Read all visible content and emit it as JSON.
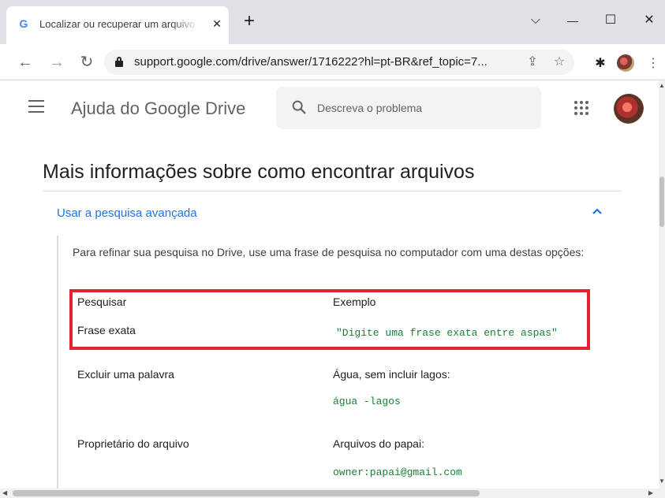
{
  "browser": {
    "tab_title": "Localizar ou recuperar um arquivo",
    "tab_favicon": "G",
    "tab_close": "✕",
    "new_tab": "+",
    "window": {
      "minimize": "—",
      "maximize": "☐",
      "close": "✕",
      "tabsearch": "⌵"
    },
    "url": "support.google.com/drive/answer/1716222?hl=pt-BR&ref_topic=7...",
    "icons": [
      "back-icon",
      "forward-icon",
      "reload-icon",
      "lock-icon",
      "share-icon",
      "star-icon",
      "extensions-icon",
      "kebab-menu-icon"
    ]
  },
  "header": {
    "title": "Ajuda do Google Drive",
    "search_placeholder": "Descreva o problema"
  },
  "article": {
    "section_heading": "Mais informações sobre como encontrar arquivos",
    "accordion_title": "Usar a pesquisa avançada",
    "intro": "Para refinar sua pesquisa no Drive, use uma frase de pesquisa no computador com uma destas opções:",
    "table": {
      "headers": [
        "Pesquisar",
        "Exemplo"
      ],
      "rows": [
        {
          "search": "Frase exata",
          "desc": "",
          "code": "\"Digite uma frase exata entre aspas\""
        },
        {
          "search": "Excluir uma palavra",
          "desc": "Água, sem incluir lagos:",
          "code": "água -lagos"
        },
        {
          "search": "Proprietário do arquivo",
          "desc": "Arquivos do papai:",
          "code": "owner:papai@gmail.com"
        }
      ]
    }
  },
  "colors": {
    "link": "#1a73e8",
    "code": "#188038",
    "highlight": "#e5202f"
  }
}
